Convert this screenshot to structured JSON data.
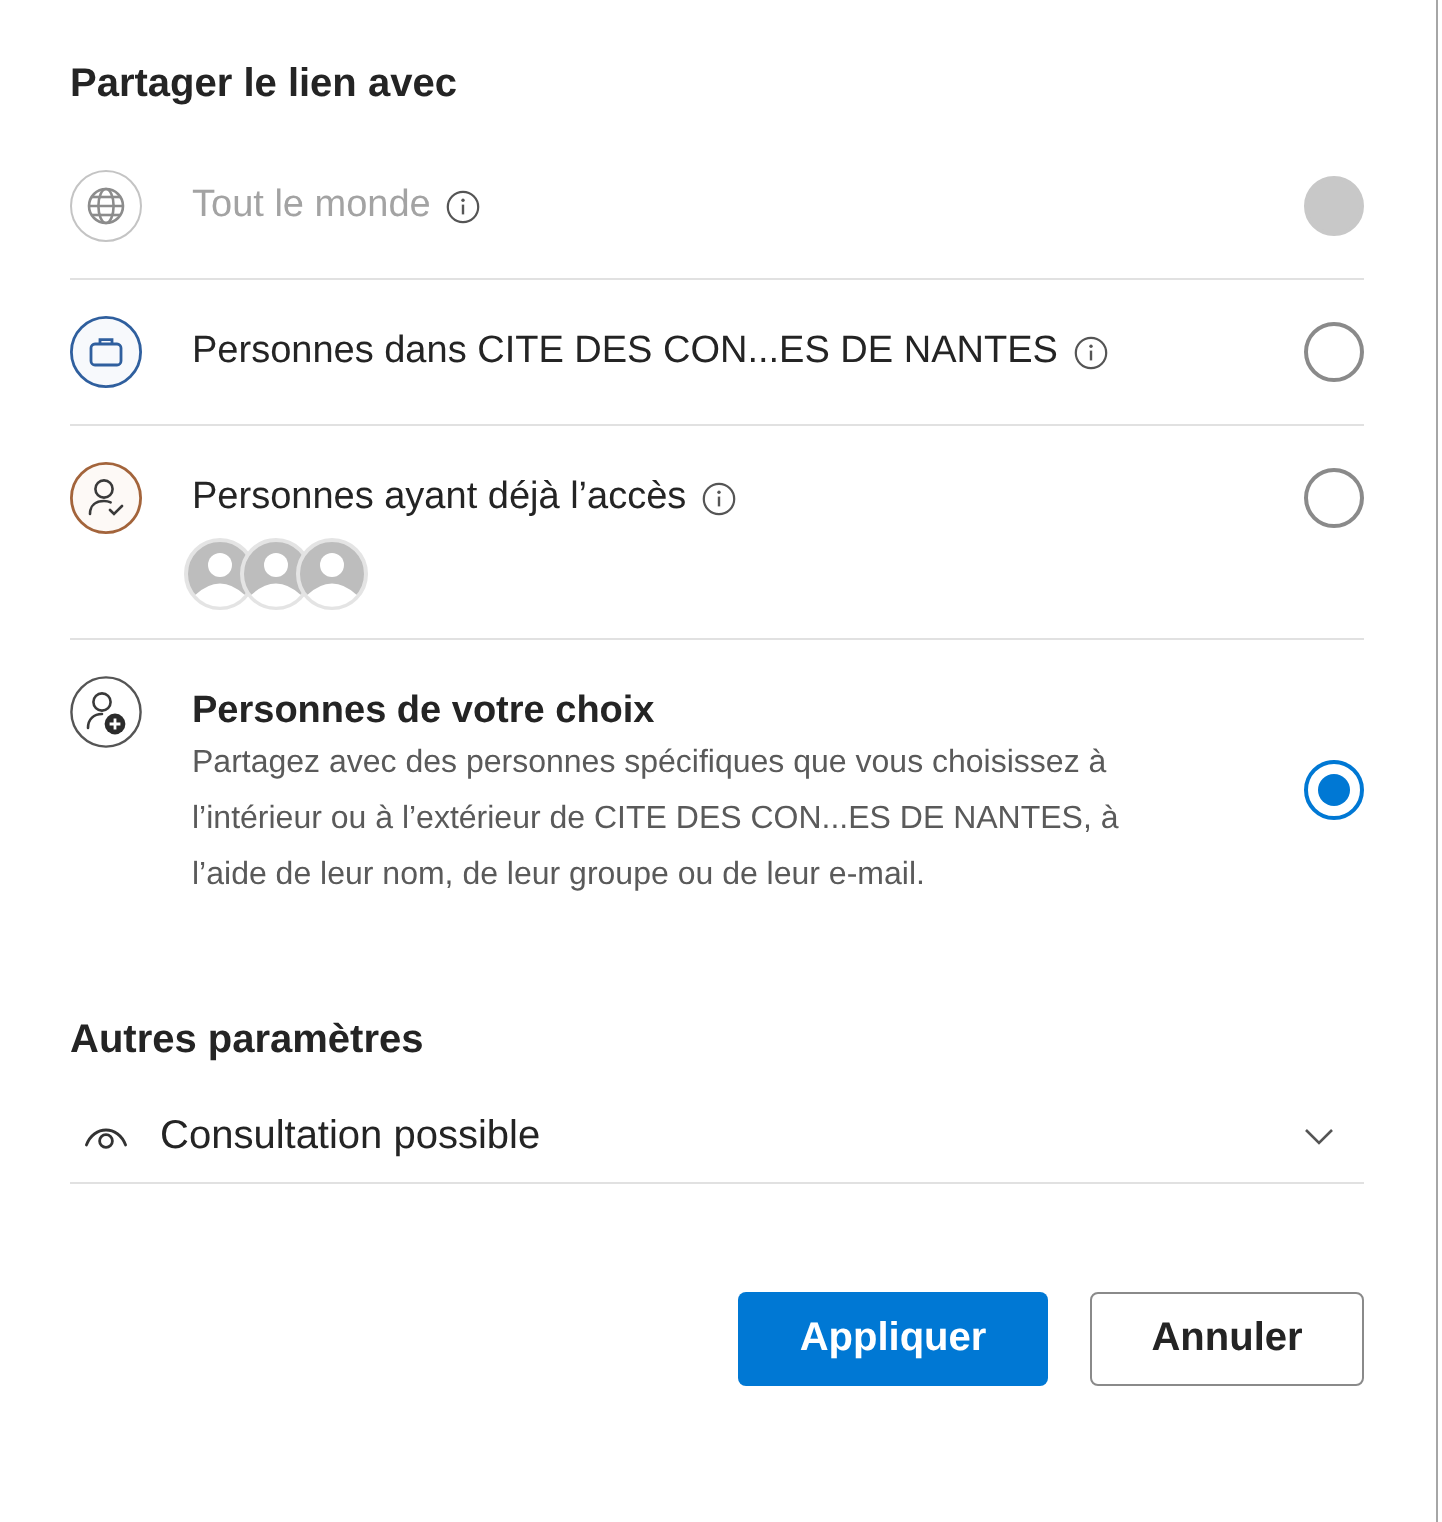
{
  "title": "Partager le lien avec",
  "options": [
    {
      "kind": "plain",
      "label": "Tout le monde",
      "info": true,
      "disabled": true,
      "selected": false
    },
    {
      "kind": "plain",
      "label": "Personnes dans CITE DES CON...ES DE NANTES",
      "info": true,
      "disabled": false,
      "selected": false
    },
    {
      "kind": "people",
      "label": "Personnes ayant déjà l’accès",
      "info": true,
      "disabled": false,
      "selected": false
    },
    {
      "kind": "described",
      "label": "Personnes de votre choix",
      "description": "Partagez avec des personnes spécifiques que vous choisissez à l’intérieur ou à l’extérieur de CITE DES CON...ES DE NANTES, à l’aide de leur nom, de leur groupe ou de leur e-mail.",
      "info": false,
      "disabled": false,
      "selected": true
    }
  ],
  "other_settings": {
    "title": "Autres paramètres",
    "permission": {
      "value": "Consultation possible"
    }
  },
  "buttons": [
    {
      "label": "Appliquer",
      "kind": "primary"
    },
    {
      "label": "Annuler",
      "kind": "secondary"
    }
  ]
}
